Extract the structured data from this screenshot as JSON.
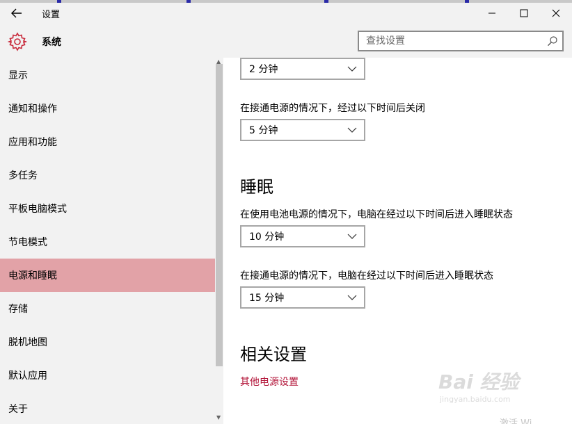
{
  "window": {
    "title": "设置",
    "back_icon": "back-arrow-icon",
    "minimize_icon": "minimize-icon",
    "maximize_icon": "maximize-icon",
    "close_icon": "close-icon"
  },
  "header": {
    "section_icon": "gear-icon",
    "section_title": "系统",
    "search_placeholder": "查找设置",
    "search_icon": "search-icon"
  },
  "sidebar": {
    "items": [
      {
        "label": "显示",
        "active": false
      },
      {
        "label": "通知和操作",
        "active": false
      },
      {
        "label": "应用和功能",
        "active": false
      },
      {
        "label": "多任务",
        "active": false
      },
      {
        "label": "平板电脑模式",
        "active": false
      },
      {
        "label": "节电模式",
        "active": false
      },
      {
        "label": "电源和睡眠",
        "active": true
      },
      {
        "label": "存储",
        "active": false
      },
      {
        "label": "脱机地图",
        "active": false
      },
      {
        "label": "默认应用",
        "active": false
      },
      {
        "label": "关于",
        "active": false
      }
    ]
  },
  "main": {
    "screen": {
      "battery_value": "2 分钟",
      "plugged_label": "在接通电源的情况下，经过以下时间后关闭",
      "plugged_value": "5 分钟"
    },
    "sleep": {
      "heading": "睡眠",
      "battery_label": "在使用电池电源的情况下，电脑在经过以下时间后进入睡眠状态",
      "battery_value": "10 分钟",
      "plugged_label": "在接通电源的情况下，电脑在经过以下时间后进入睡眠状态",
      "plugged_value": "15 分钟"
    },
    "related": {
      "heading": "相关设置",
      "link": "其他电源设置"
    }
  },
  "overlay": {
    "watermark_brand": "Bai 经验",
    "watermark_url": "jingyan.baidu.com",
    "corner_text": "激活 Wi"
  },
  "colors": {
    "accent": "#b3163a",
    "active_item": "#e2a2a7",
    "sidebar_bg": "#f2f2f2"
  }
}
